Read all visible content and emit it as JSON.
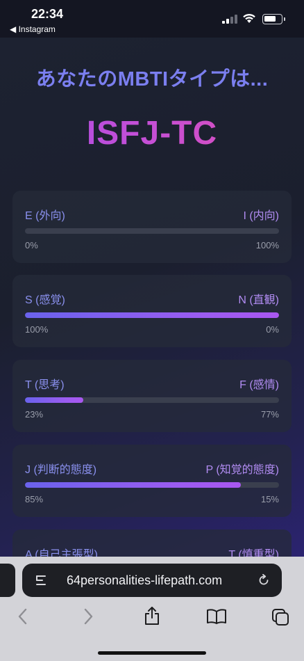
{
  "status_bar": {
    "time": "22:34",
    "back_app": "◀ Instagram"
  },
  "result": {
    "heading": "あなたのMBTIタイプは...",
    "type_code": "ISFJ-TC"
  },
  "dimensions": [
    {
      "left_label": "E (外向)",
      "right_label": "I (内向)",
      "left_pct": "0%",
      "right_pct": "100%",
      "left_value": 0
    },
    {
      "left_label": "S (感覚)",
      "right_label": "N (直観)",
      "left_pct": "100%",
      "right_pct": "0%",
      "left_value": 100
    },
    {
      "left_label": "T (思考)",
      "right_label": "F (感情)",
      "left_pct": "23%",
      "right_pct": "77%",
      "left_value": 23
    },
    {
      "left_label": "J (判断的態度)",
      "right_label": "P (知覚的態度)",
      "left_pct": "85%",
      "right_pct": "15%",
      "left_value": 85
    },
    {
      "left_label": "A (自己主張型)",
      "right_label": "T (慎重型)",
      "left_pct": "",
      "right_pct": "",
      "left_value": null
    }
  ],
  "browser": {
    "url": "64personalities-lifepath.com",
    "toolbar": [
      "back-icon",
      "forward-icon",
      "share-icon",
      "bookmarks-icon",
      "tabs-icon"
    ]
  },
  "colors": {
    "accent": "#7b7ff0",
    "type_gradient": [
      "#a74de6",
      "#e04fb2"
    ],
    "bar_fill": [
      "#6a62ec",
      "#a957f0"
    ]
  }
}
